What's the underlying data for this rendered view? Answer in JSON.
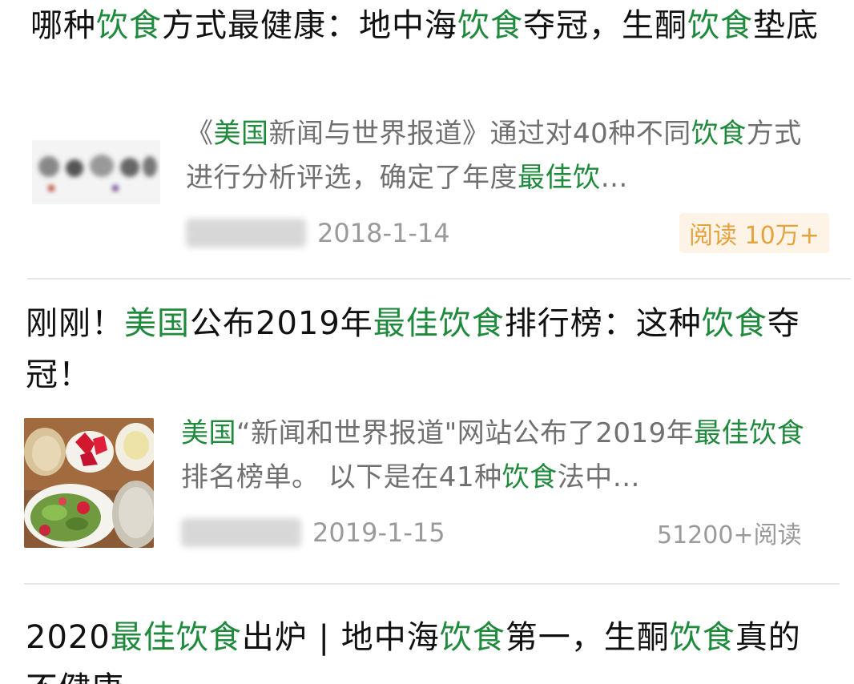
{
  "articles": [
    {
      "title_segments": [
        {
          "text": "哪种",
          "hl": false
        },
        {
          "text": "饮食",
          "hl": true
        },
        {
          "text": "方式最健康：地中海",
          "hl": false
        },
        {
          "text": "饮食",
          "hl": true
        },
        {
          "text": "夺冠，生酮",
          "hl": false
        },
        {
          "text": "饮食",
          "hl": true
        },
        {
          "text": "垫底",
          "hl": false
        }
      ],
      "desc_segments": [
        {
          "text": "《",
          "hl": false
        },
        {
          "text": "美国",
          "hl": true
        },
        {
          "text": "新闻与世界报道》通过对40种不同",
          "hl": false
        },
        {
          "text": "饮食",
          "hl": true
        },
        {
          "text": "方式进行分析评选，确定了年度",
          "hl": false
        },
        {
          "text": "最佳饮",
          "hl": true
        },
        {
          "text": "…",
          "hl": false
        }
      ],
      "date": "2018-1-14",
      "reads": "阅读 10万+"
    },
    {
      "title_segments": [
        {
          "text": "刚刚！",
          "hl": false
        },
        {
          "text": "美国",
          "hl": true
        },
        {
          "text": "公布2019年",
          "hl": false
        },
        {
          "text": "最佳饮食",
          "hl": true
        },
        {
          "text": "排行榜：这种",
          "hl": false
        },
        {
          "text": "饮食",
          "hl": true
        },
        {
          "text": "夺冠！",
          "hl": false
        }
      ],
      "desc_segments": [
        {
          "text": "美国",
          "hl": true
        },
        {
          "text": "“新闻和世界报道\"网站公布了2019年",
          "hl": false
        },
        {
          "text": "最佳饮食",
          "hl": true
        },
        {
          "text": "排名榜单。 以下是在41种",
          "hl": false
        },
        {
          "text": "饮食",
          "hl": true
        },
        {
          "text": "法中…",
          "hl": false
        }
      ],
      "date": "2019-1-15",
      "reads": "51200+阅读"
    },
    {
      "title_segments": [
        {
          "text": "2020",
          "hl": false
        },
        {
          "text": "最佳饮食",
          "hl": true
        },
        {
          "text": "出炉 | 地中海",
          "hl": false
        },
        {
          "text": "饮食",
          "hl": true
        },
        {
          "text": "第一，生酮",
          "hl": false
        },
        {
          "text": "饮食",
          "hl": true
        },
        {
          "text": "真的不健康",
          "hl": false
        }
      ]
    }
  ],
  "colors": {
    "highlight": "#1f8a3c",
    "hot_badge_bg": "#fdf4e7",
    "hot_badge_text": "#e6a23c"
  }
}
